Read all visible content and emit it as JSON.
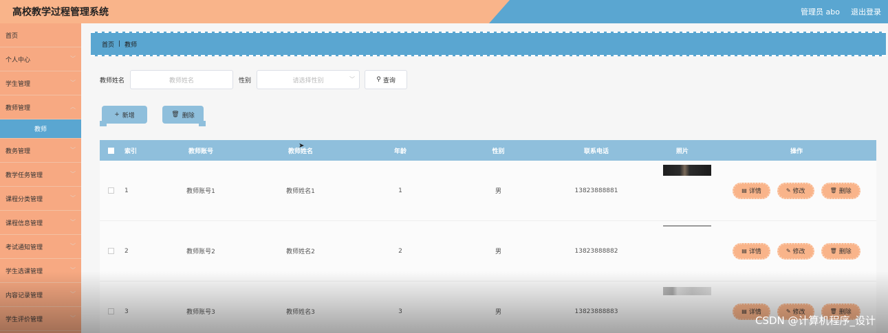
{
  "header": {
    "title": "高校教学过程管理系统",
    "admin": "管理员 abo",
    "logout": "退出登录"
  },
  "sidebar": {
    "items": [
      {
        "label": "首页",
        "chevron": false
      },
      {
        "label": "个人中心",
        "chevron": true
      },
      {
        "label": "学生管理",
        "chevron": true
      },
      {
        "label": "教师管理",
        "chevron": true
      },
      {
        "label": "教务管理",
        "chevron": true
      },
      {
        "label": "教学任务管理",
        "chevron": true
      },
      {
        "label": "课程分类管理",
        "chevron": true
      },
      {
        "label": "课程信息管理",
        "chevron": true
      },
      {
        "label": "考试通知管理",
        "chevron": true
      },
      {
        "label": "学生选课管理",
        "chevron": true
      },
      {
        "label": "内容记录管理",
        "chevron": true
      },
      {
        "label": "学生评价管理",
        "chevron": true
      }
    ],
    "sub_active": "教师"
  },
  "breadcrumb": {
    "home": "首页",
    "current": "教师"
  },
  "search": {
    "name_label": "教师姓名",
    "name_placeholder": "教师姓名",
    "gender_label": "性别",
    "gender_placeholder": "请选择性别",
    "query_button": "查询"
  },
  "actions": {
    "add": "新增",
    "delete": "删除"
  },
  "table": {
    "headers": [
      "索引",
      "教师账号",
      "教师姓名",
      "年龄",
      "性别",
      "联系电话",
      "照片",
      "操作"
    ],
    "rows": [
      {
        "index": "1",
        "account": "教师账号1",
        "name": "教师姓名1",
        "age": "1",
        "gender": "男",
        "phone": "13823888881"
      },
      {
        "index": "2",
        "account": "教师账号2",
        "name": "教师姓名2",
        "age": "2",
        "gender": "男",
        "phone": "13823888882"
      },
      {
        "index": "3",
        "account": "教师账号3",
        "name": "教师姓名3",
        "age": "3",
        "gender": "男",
        "phone": "13823888883"
      }
    ],
    "ops": {
      "detail": "详情",
      "edit": "修改",
      "delete": "删除"
    }
  },
  "watermark": "CSDN @计算机程序_设计",
  "colors": {
    "peach": "#f9b48a",
    "blue": "#5aa6d1",
    "light_blue": "#8fbfdc"
  }
}
